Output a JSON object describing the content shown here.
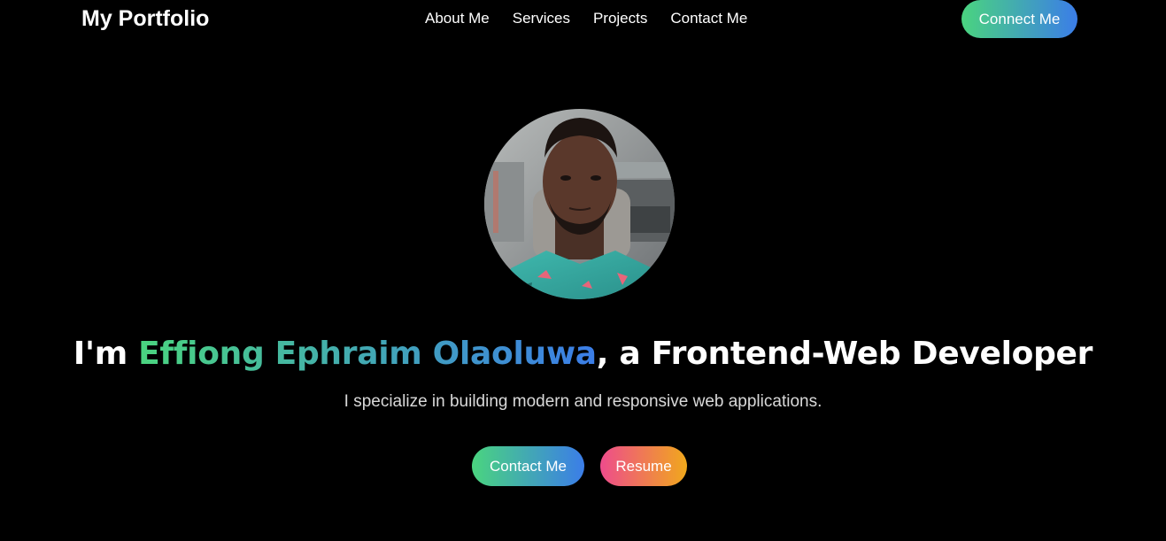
{
  "nav": {
    "brand": "My Portfolio",
    "links": [
      "About Me",
      "Services",
      "Projects",
      "Contact Me"
    ],
    "connect_label": "Connect Me"
  },
  "hero": {
    "avatar_icon": "profile-photo",
    "headline_prefix": "I'm ",
    "name": "Effiong Ephraim Olaoluwa",
    "headline_suffix": ", a Frontend-Web Developer",
    "tagline": "I specialize in building modern and responsive web applications.",
    "buttons": {
      "contact_label": "Contact Me",
      "resume_label": "Resume"
    }
  },
  "colors": {
    "background": "#000000",
    "text": "#ffffff",
    "green": "#4ad47f",
    "blue": "#3b7de8",
    "pink": "#ee4c8c",
    "orange": "#f0a81c"
  }
}
